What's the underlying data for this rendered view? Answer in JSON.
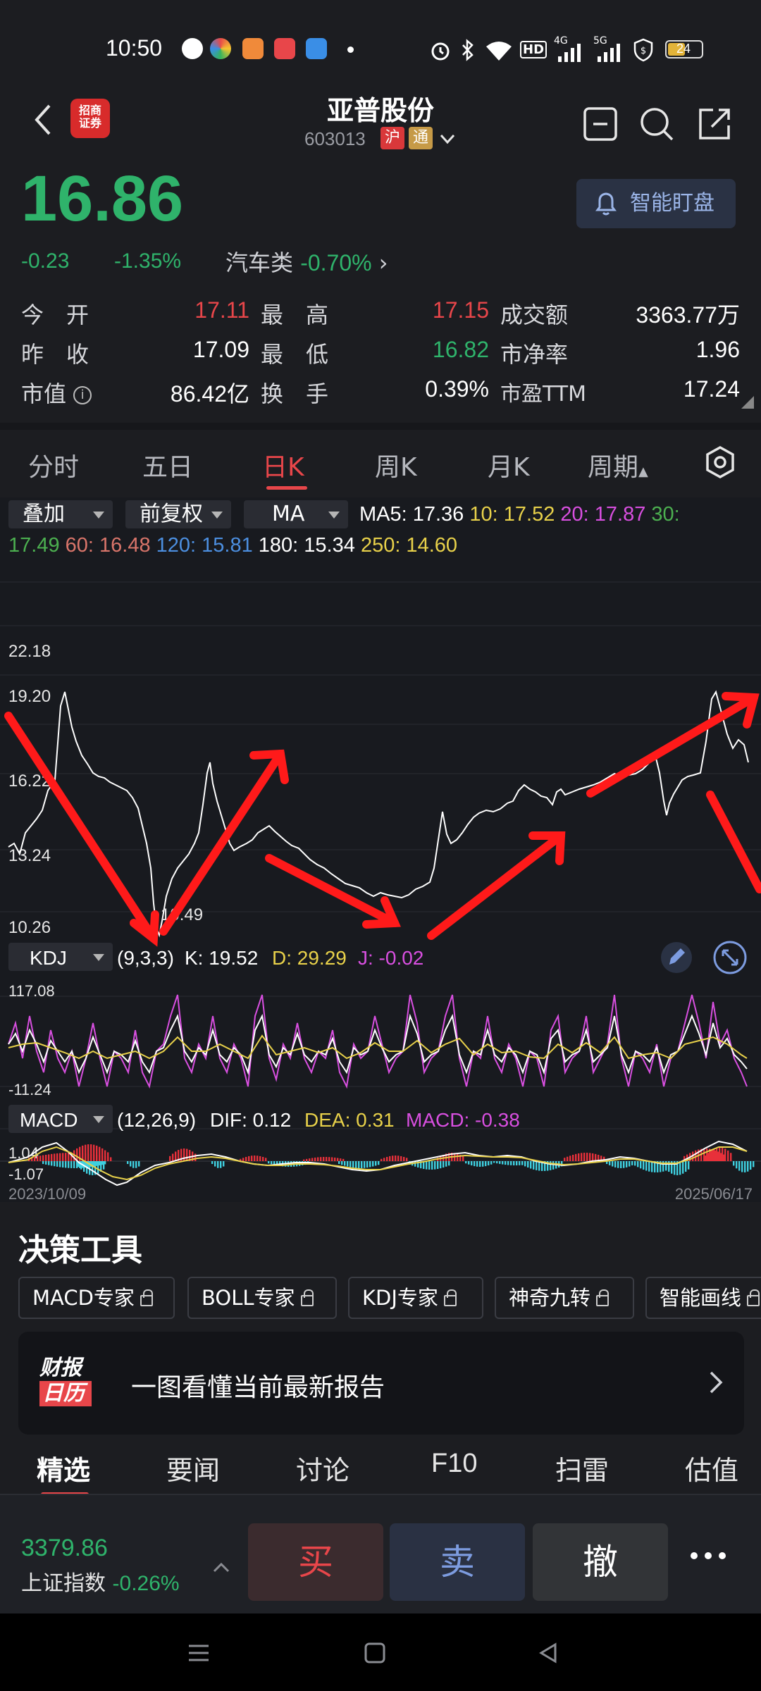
{
  "status_bar": {
    "time": "10:50",
    "battery": "24",
    "icons": [
      "wechat-icon",
      "app-icon",
      "app-icon",
      "toutiao-icon",
      "app-icon",
      "dot-icon",
      "alarm-icon",
      "bluetooth-icon",
      "wifi-icon",
      "hd-icon",
      "signal-4g-icon",
      "signal-5g-icon",
      "shield-icon",
      "battery-icon"
    ],
    "hd": "HD",
    "net_4g": "4G",
    "net_5g": "5G"
  },
  "header": {
    "broker_logo_line1": "招商",
    "broker_logo_line2": "证券",
    "stock_name": "亚普股份",
    "stock_code": "603013",
    "badge_hu": "沪",
    "badge_tong": "通"
  },
  "quote": {
    "price": "16.86",
    "change": "-0.23",
    "change_pct": "-1.35%",
    "sector_name": "汽车类",
    "sector_pct": "-0.70%",
    "smart_button": "智能盯盘",
    "rows": [
      [
        {
          "label": "今　开",
          "value": "17.11",
          "color": "red"
        },
        {
          "label": "最　高",
          "value": "17.15",
          "color": "red"
        },
        {
          "label": "成交额",
          "value": "3363.77万",
          "color": "white"
        }
      ],
      [
        {
          "label": "昨　收",
          "value": "17.09",
          "color": "white"
        },
        {
          "label": "最　低",
          "value": "16.82",
          "color": "green"
        },
        {
          "label": "市净率",
          "value": "1.96",
          "color": "white"
        }
      ],
      [
        {
          "label": "市值",
          "value": "86.42亿",
          "color": "white"
        },
        {
          "label": "换　手",
          "value": "0.39%",
          "color": "white"
        },
        {
          "label": "市盈TTM",
          "value": "17.24",
          "color": "white"
        }
      ]
    ]
  },
  "tabs": [
    "分时",
    "五日",
    "日K",
    "周K",
    "月K",
    "周期"
  ],
  "active_tab": "日K",
  "chart": {
    "dropdowns": [
      "叠加",
      "前复权",
      "MA"
    ],
    "ma_line1": [
      {
        "text": "MA5: 17.36",
        "color": "#ffffff"
      },
      {
        "text": "10: 17.52",
        "color": "#e8d14a"
      },
      {
        "text": "20: 17.87",
        "color": "#d84fe0"
      },
      {
        "text": "30:",
        "color": "#4cb050"
      }
    ],
    "ma_line2": [
      {
        "text": "17.49",
        "color": "#4cb050"
      },
      {
        "text": "60: 16.48",
        "color": "#d9756a"
      },
      {
        "text": "120: 15.81",
        "color": "#4c8fe0"
      },
      {
        "text": "180: 15.34",
        "color": "#ffffff"
      },
      {
        "text": "250: 14.60",
        "color": "#e8d14a"
      }
    ],
    "price_axis": [
      "22.18",
      "19.20",
      "16.22",
      "13.24",
      "10.26"
    ],
    "low_label": "10.49",
    "kdj": {
      "name": "KDJ",
      "params": "(9,3,3)",
      "k": "K: 19.52",
      "d": "D: 29.29",
      "j": "J: -0.02",
      "axis_top": "117.08",
      "axis_bottom": "-11.24"
    },
    "macd": {
      "name": "MACD",
      "params": "(12,26,9)",
      "dif": "DIF: 0.12",
      "dea": "DEA: 0.31",
      "macd": "MACD: -0.38",
      "axis_top": "1.04",
      "axis_bottom": "-1.07"
    },
    "date_start": "2023/10/09",
    "date_end": "2025/06/17"
  },
  "tools": {
    "title": "决策工具",
    "items": [
      "MACD专家",
      "BOLL专家",
      "KDJ专家",
      "神奇九转",
      "智能画线"
    ]
  },
  "report": {
    "logo_line1": "财报",
    "logo_line2": "日历",
    "text": "一图看懂当前最新报告"
  },
  "nav_tabs": [
    "精选",
    "要闻",
    "讨论",
    "F10",
    "扫雷",
    "估值"
  ],
  "active_nav": "精选",
  "index_bar": {
    "value": "3379.86",
    "name": "上证指数",
    "pct": "-0.26%"
  },
  "trade": {
    "buy": "买",
    "sell": "卖",
    "cancel": "撤"
  }
}
